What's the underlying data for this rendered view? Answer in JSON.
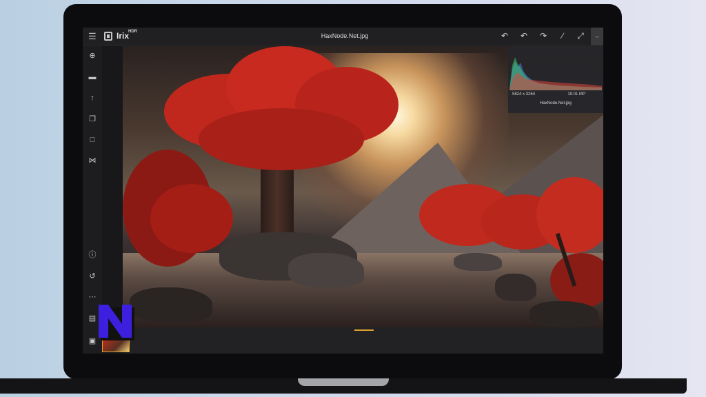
{
  "window": {
    "app_name": "Irix",
    "app_name_sup": "HDR",
    "file_title": "HaxNode.Net.jpg"
  },
  "toolbar": {
    "icons": [
      "undo-all-icon",
      "undo-icon",
      "redo-icon",
      "compare-icon",
      "fullscreen-icon",
      "collapse-icon"
    ]
  },
  "sidebar": {
    "icons": [
      "add-icon",
      "folder-icon",
      "export-icon",
      "copy-icon",
      "window-icon",
      "panorama-icon",
      "info-icon",
      "history-icon",
      "more-icon",
      "open-folder-icon",
      "gallery-icon"
    ]
  },
  "histogram": {
    "dimensions": "5824 x 3264",
    "megapixels": "19.01 MP",
    "filename": "HaxNode.Net.jpg",
    "colors": {
      "red": "#e0463c",
      "green": "#3cc46a",
      "blue": "#4a8ae8"
    }
  },
  "watermark": {
    "letter": "N",
    "color": "#3d1fe0"
  },
  "colors": {
    "accent": "#e0a030",
    "foliage": "#c0281e"
  }
}
